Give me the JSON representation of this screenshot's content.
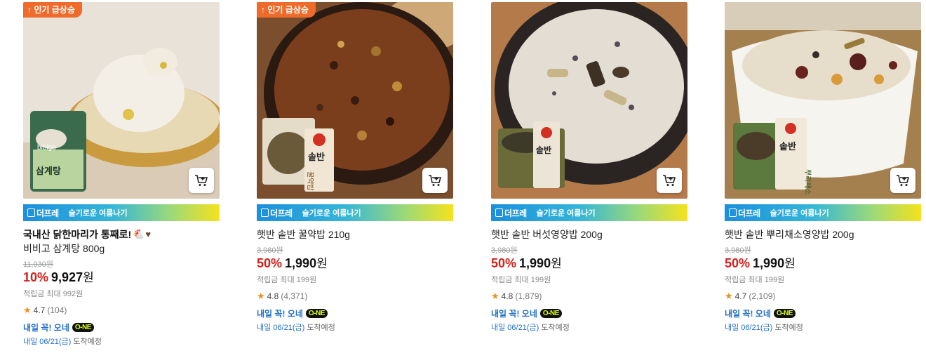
{
  "products": [
    {
      "badge": "↑ 인기 급상승",
      "promo": {
        "logo": "더프레",
        "text": "슬기로운 여름나기"
      },
      "title_line1": "국내산 닭한마리가 통째로!",
      "title_line2": "비비고 삼계탕 800g",
      "original_price": "11,030원",
      "discount": "10%",
      "price": "9,927",
      "currency": "원",
      "points": "적립금 최대 992원",
      "rating": "4.7",
      "reviews": "(104)",
      "delivery_label": "내일 꼭! 오네",
      "one_logo": "O-NE",
      "arrival_date": "내일 06/21(금)",
      "arrival_suffix": "도착예정",
      "package_label": "삼계탕",
      "brand": "bibigo"
    },
    {
      "badge": "↑ 인기 급상승",
      "promo": {
        "logo": "더프레",
        "text": "슬기로운 여름나기"
      },
      "title_line1": "",
      "title_line2": "햇반 솥반 꿀약밥 210g",
      "original_price": "3,980원",
      "discount": "50%",
      "price": "1,990",
      "currency": "원",
      "points": "적립금 최대 199원",
      "rating": "4.8",
      "reviews": "(4,371)",
      "delivery_label": "내일 꼭! 오네",
      "one_logo": "O-NE",
      "arrival_date": "내일 06/21(금)",
      "arrival_suffix": "도착예정",
      "package_label": "꿀약밥",
      "brand": "솥반"
    },
    {
      "badge": "",
      "promo": {
        "logo": "더프레",
        "text": "슬기로운 여름나기"
      },
      "title_line1": "",
      "title_line2": "햇반 솥반 버섯영양밥 200g",
      "original_price": "3,980원",
      "discount": "50%",
      "price": "1,990",
      "currency": "원",
      "points": "적립금 최대 199원",
      "rating": "4.8",
      "reviews": "(1,879)",
      "delivery_label": "내일 꼭! 오네",
      "one_logo": "O-NE",
      "arrival_date": "내일 06/21(금)",
      "arrival_suffix": "도착예정",
      "package_label": "",
      "brand": "솥반"
    },
    {
      "badge": "",
      "promo": {
        "logo": "더프레",
        "text": "슬기로운 여름나기"
      },
      "title_line1": "",
      "title_line2": "햇반 솥반 뿌리채소영양밥 200g",
      "original_price": "3,980원",
      "discount": "50%",
      "price": "1,990",
      "currency": "원",
      "points": "적립금 최대 199원",
      "rating": "4.7",
      "reviews": "(2,109)",
      "delivery_label": "내일 꼭! 오네",
      "one_logo": "O-NE",
      "arrival_date": "내일 06/21(금)",
      "arrival_suffix": "도착예정",
      "package_label": "뿌리채소",
      "brand": "솥반"
    }
  ],
  "colors": {
    "badge": "#ef6b2b",
    "discount": "#d3201a",
    "delivery": "#1e6ec8",
    "star": "#f28c1b"
  }
}
